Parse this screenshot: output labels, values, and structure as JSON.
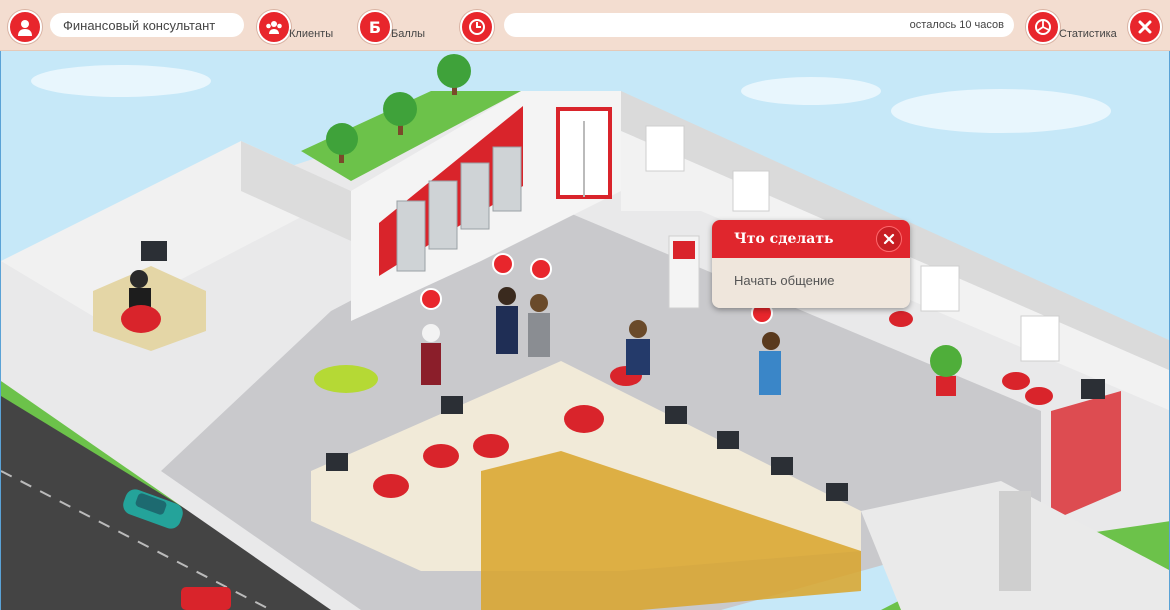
{
  "header": {
    "role_title": "Финансовый консультант",
    "clients_label": "Клиенты",
    "points_label": "Баллы",
    "time_remaining": "осталось 10 часов",
    "stats_label": "Статистика"
  },
  "icons": {
    "avatar": "avatar-icon",
    "clients": "users-icon",
    "points": "coin-icon",
    "clock": "clock-icon",
    "stats": "pie-chart-icon",
    "close": "close-icon"
  },
  "popup": {
    "title": "Что сделать",
    "actions": [
      "Начать общение"
    ]
  },
  "colors": {
    "accent": "#e8262c",
    "topbar_bg": "#f3ddd0",
    "popup_body": "#efe6dc"
  }
}
